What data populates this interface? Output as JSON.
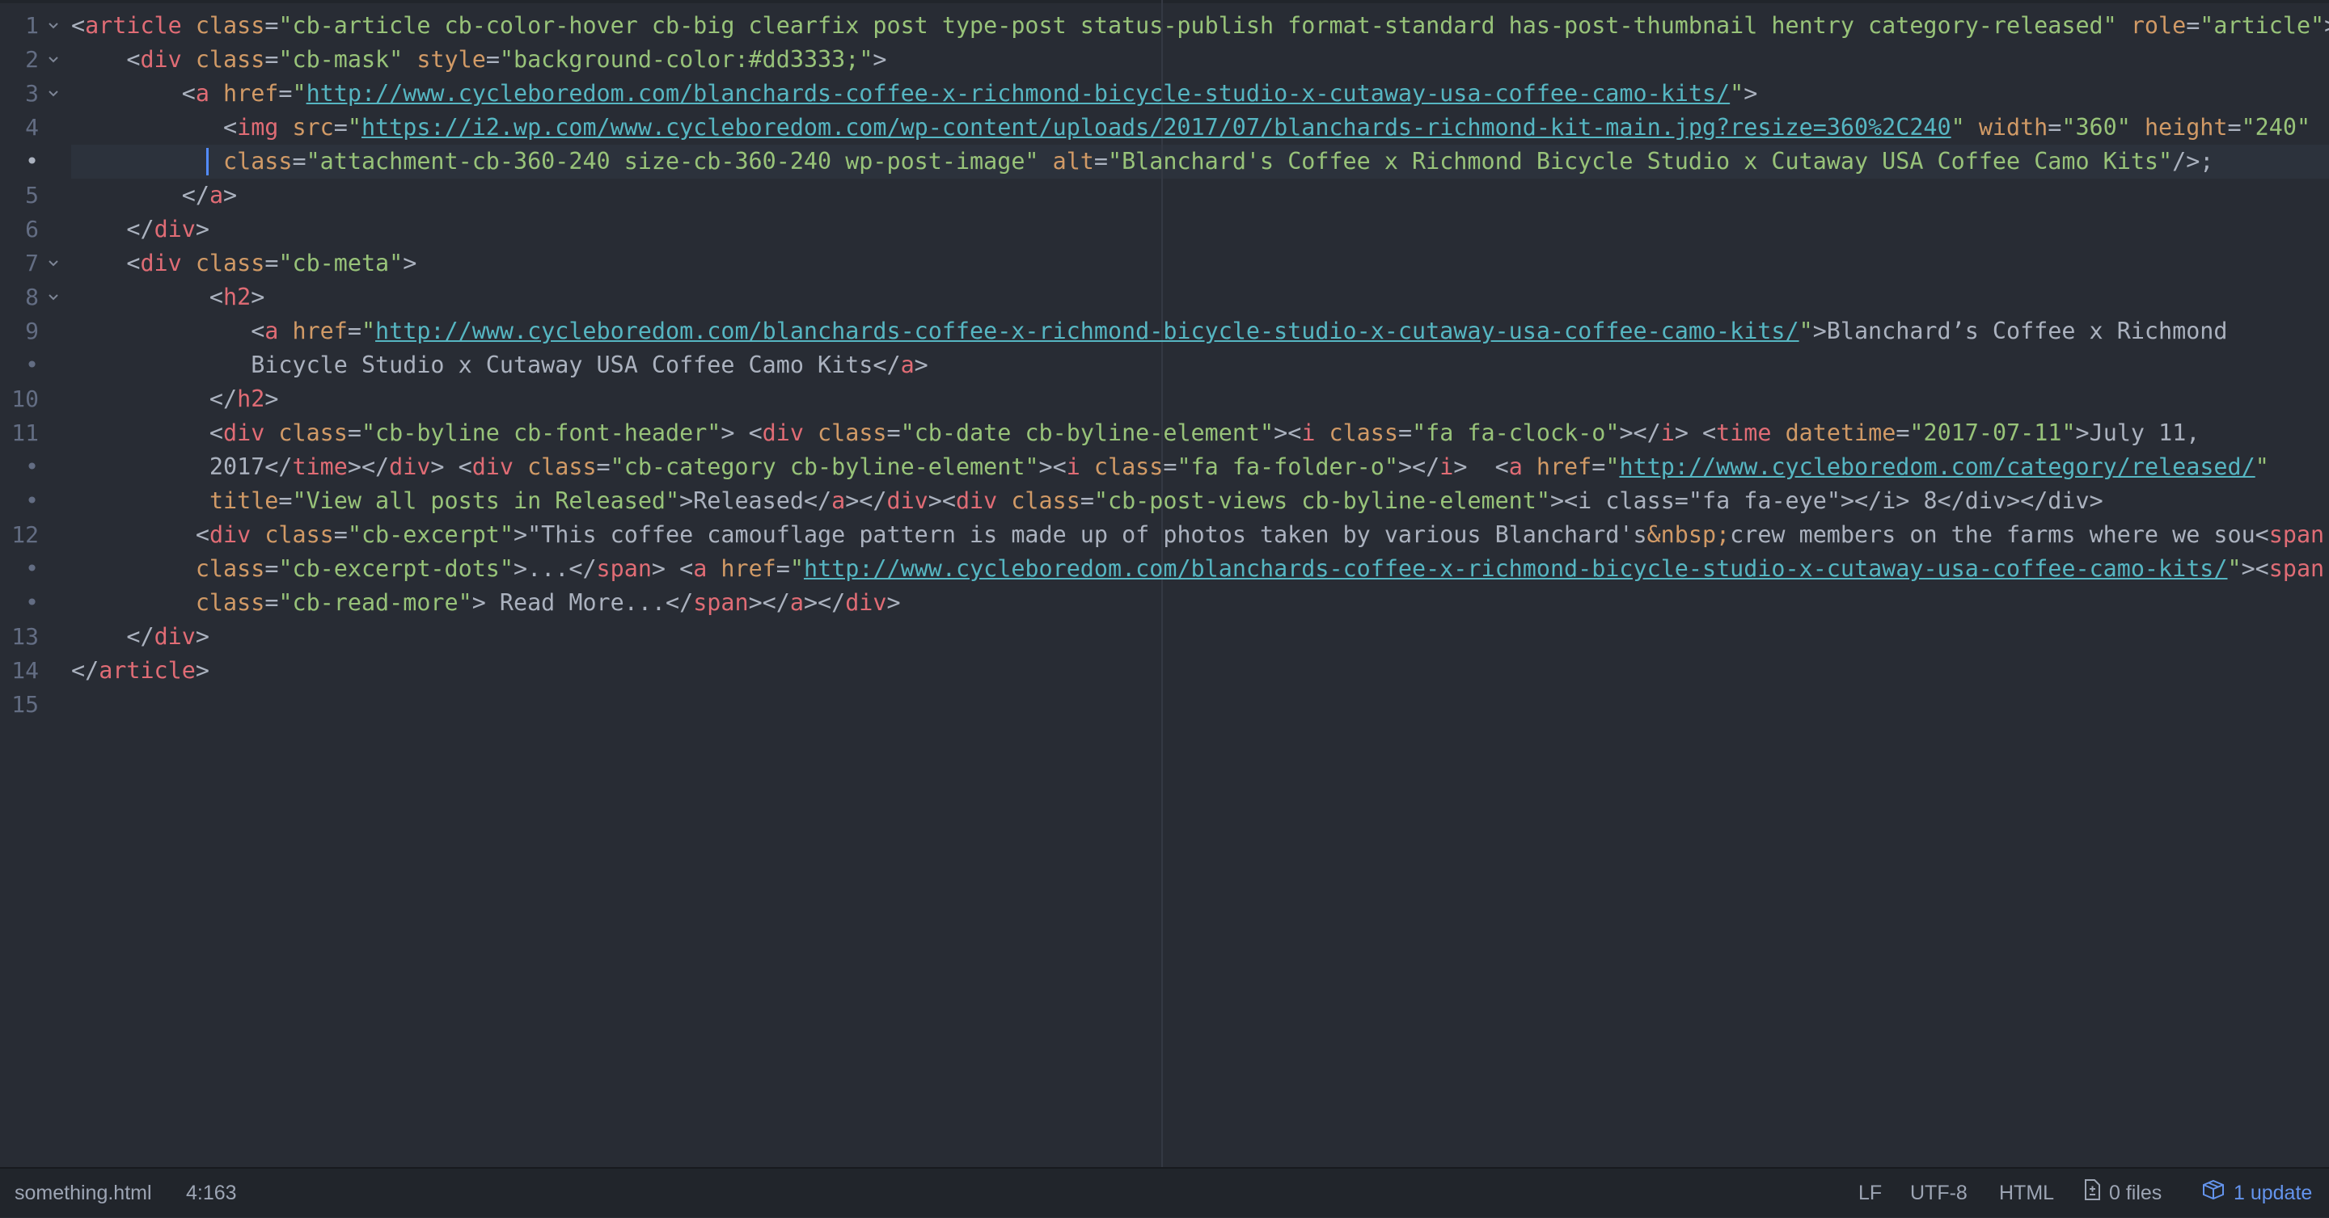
{
  "editor": {
    "lines": [
      {
        "num": "1",
        "fold": true,
        "segments": [
          [
            "p",
            "<"
          ],
          [
            "t",
            "article"
          ],
          [
            "p",
            " "
          ],
          [
            "a",
            "class"
          ],
          [
            "p",
            "="
          ],
          [
            "s",
            "\"cb-article cb-color-hover cb-big clearfix post type-post status-publish format-standard has-post-thumbnail hentry category-released\""
          ],
          [
            "p",
            " "
          ],
          [
            "a",
            "role"
          ],
          [
            "p",
            "="
          ],
          [
            "s",
            "\"article\""
          ],
          [
            "p",
            ">"
          ]
        ]
      },
      {
        "num": "2",
        "fold": true,
        "segments": [
          [
            "p",
            "    <"
          ],
          [
            "t",
            "div"
          ],
          [
            "p",
            " "
          ],
          [
            "a",
            "class"
          ],
          [
            "p",
            "="
          ],
          [
            "s",
            "\"cb-mask\""
          ],
          [
            "p",
            " "
          ],
          [
            "a",
            "style"
          ],
          [
            "p",
            "="
          ],
          [
            "s",
            "\"background-color:#dd3333;\""
          ],
          [
            "p",
            ">"
          ]
        ]
      },
      {
        "num": "3",
        "fold": true,
        "segments": [
          [
            "p",
            "        <"
          ],
          [
            "t",
            "a"
          ],
          [
            "p",
            " "
          ],
          [
            "a",
            "href"
          ],
          [
            "p",
            "="
          ],
          [
            "s",
            "\""
          ],
          [
            "u",
            "http://www.cycleboredom.com/blanchards-coffee-x-richmond-bicycle-studio-x-cutaway-usa-coffee-camo-kits/"
          ],
          [
            "s",
            "\""
          ],
          [
            "p",
            ">"
          ]
        ]
      },
      {
        "num": "4",
        "fold": false,
        "segments": [
          [
            "p",
            "           <"
          ],
          [
            "t",
            "img"
          ],
          [
            "p",
            " "
          ],
          [
            "a",
            "src"
          ],
          [
            "p",
            "="
          ],
          [
            "s",
            "\""
          ],
          [
            "u",
            "https://i2.wp.com/www.cycleboredom.com/wp-content/uploads/2017/07/blanchards-richmond-kit-main.jpg?resize=360%2C240"
          ],
          [
            "s",
            "\""
          ],
          [
            "p",
            " "
          ],
          [
            "a",
            "width"
          ],
          [
            "p",
            "="
          ],
          [
            "s",
            "\"360\""
          ],
          [
            "p",
            " "
          ],
          [
            "a",
            "height"
          ],
          [
            "p",
            "="
          ],
          [
            "s",
            "\"240\""
          ]
        ]
      },
      {
        "num": "•",
        "fold": false,
        "segments": [
          [
            "p",
            "           "
          ],
          [
            "a",
            "class"
          ],
          [
            "p",
            "="
          ],
          [
            "s",
            "\"attachment-cb-360-240 size-cb-360-240 wp-post-image\""
          ],
          [
            "p",
            " "
          ],
          [
            "a",
            "alt"
          ],
          [
            "p",
            "="
          ],
          [
            "s",
            "\"Blanchard's Coffee x Richmond Bicycle Studio x Cutaway USA Coffee Camo Kits\""
          ],
          [
            "p",
            "/>;"
          ]
        ]
      },
      {
        "num": "5",
        "fold": false,
        "segments": [
          [
            "p",
            "        </"
          ],
          [
            "t",
            "a"
          ],
          [
            "p",
            ">"
          ]
        ]
      },
      {
        "num": "6",
        "fold": false,
        "segments": [
          [
            "p",
            "    </"
          ],
          [
            "t",
            "div"
          ],
          [
            "p",
            ">"
          ]
        ]
      },
      {
        "num": "7",
        "fold": true,
        "segments": [
          [
            "p",
            "    <"
          ],
          [
            "t",
            "div"
          ],
          [
            "p",
            " "
          ],
          [
            "a",
            "class"
          ],
          [
            "p",
            "="
          ],
          [
            "s",
            "\"cb-meta\""
          ],
          [
            "p",
            ">"
          ]
        ]
      },
      {
        "num": "8",
        "fold": true,
        "segments": [
          [
            "p",
            "          <"
          ],
          [
            "t",
            "h2"
          ],
          [
            "p",
            ">"
          ]
        ]
      },
      {
        "num": "9",
        "fold": false,
        "segments": [
          [
            "p",
            "             <"
          ],
          [
            "t",
            "a"
          ],
          [
            "p",
            " "
          ],
          [
            "a",
            "href"
          ],
          [
            "p",
            "="
          ],
          [
            "s",
            "\""
          ],
          [
            "u",
            "http://www.cycleboredom.com/blanchards-coffee-x-richmond-bicycle-studio-x-cutaway-usa-coffee-camo-kits/"
          ],
          [
            "s",
            "\""
          ],
          [
            "p",
            ">Blanchard’s Coffee x Richmond"
          ]
        ]
      },
      {
        "num": "•",
        "fold": false,
        "segments": [
          [
            "p",
            "             Bicycle Studio x Cutaway USA Coffee Camo Kits</"
          ],
          [
            "t",
            "a"
          ],
          [
            "p",
            ">"
          ]
        ]
      },
      {
        "num": "10",
        "fold": false,
        "segments": [
          [
            "p",
            "          </"
          ],
          [
            "t",
            "h2"
          ],
          [
            "p",
            ">"
          ]
        ]
      },
      {
        "num": "11",
        "fold": false,
        "segments": [
          [
            "p",
            "          <"
          ],
          [
            "t",
            "div"
          ],
          [
            "p",
            " "
          ],
          [
            "a",
            "class"
          ],
          [
            "p",
            "="
          ],
          [
            "s",
            "\"cb-byline cb-font-header\""
          ],
          [
            "p",
            "> <"
          ],
          [
            "t",
            "div"
          ],
          [
            "p",
            " "
          ],
          [
            "a",
            "class"
          ],
          [
            "p",
            "="
          ],
          [
            "s",
            "\"cb-date cb-byline-element\""
          ],
          [
            "p",
            "><"
          ],
          [
            "t",
            "i"
          ],
          [
            "p",
            " "
          ],
          [
            "a",
            "class"
          ],
          [
            "p",
            "="
          ],
          [
            "s",
            "\"fa fa-clock-o\""
          ],
          [
            "p",
            "></"
          ],
          [
            "t",
            "i"
          ],
          [
            "p",
            "> <"
          ],
          [
            "t",
            "time"
          ],
          [
            "p",
            " "
          ],
          [
            "a",
            "datetime"
          ],
          [
            "p",
            "="
          ],
          [
            "s",
            "\"2017-07-11\""
          ],
          [
            "p",
            ">July 11,"
          ]
        ]
      },
      {
        "num": "•",
        "fold": false,
        "segments": [
          [
            "p",
            "          2017</"
          ],
          [
            "t",
            "time"
          ],
          [
            "p",
            "></"
          ],
          [
            "t",
            "div"
          ],
          [
            "p",
            "> <"
          ],
          [
            "t",
            "div"
          ],
          [
            "p",
            " "
          ],
          [
            "a",
            "class"
          ],
          [
            "p",
            "="
          ],
          [
            "s",
            "\"cb-category cb-byline-element\""
          ],
          [
            "p",
            "><"
          ],
          [
            "t",
            "i"
          ],
          [
            "p",
            " "
          ],
          [
            "a",
            "class"
          ],
          [
            "p",
            "="
          ],
          [
            "s",
            "\"fa fa-folder-o\""
          ],
          [
            "p",
            "></"
          ],
          [
            "t",
            "i"
          ],
          [
            "p",
            ">  <"
          ],
          [
            "t",
            "a"
          ],
          [
            "p",
            " "
          ],
          [
            "a",
            "href"
          ],
          [
            "p",
            "="
          ],
          [
            "s",
            "\""
          ],
          [
            "u",
            "http://www.cycleboredom.com/category/released/"
          ],
          [
            "s",
            "\""
          ]
        ]
      },
      {
        "num": "•",
        "fold": false,
        "segments": [
          [
            "p",
            "          "
          ],
          [
            "a",
            "title"
          ],
          [
            "p",
            "="
          ],
          [
            "s",
            "\"View all posts in Released\""
          ],
          [
            "p",
            ">Released</"
          ],
          [
            "t",
            "a"
          ],
          [
            "p",
            "></"
          ],
          [
            "t",
            "div"
          ],
          [
            "p",
            "><"
          ],
          [
            "t",
            "div"
          ],
          [
            "p",
            " "
          ],
          [
            "a",
            "class"
          ],
          [
            "p",
            "="
          ],
          [
            "s",
            "\"cb-post-views cb-byline-element\""
          ],
          [
            "p",
            "><i class=\"fa fa-eye\"></i> 8</div></div>"
          ]
        ]
      },
      {
        "num": "12",
        "fold": false,
        "segments": [
          [
            "p",
            "         <"
          ],
          [
            "t",
            "div"
          ],
          [
            "p",
            " "
          ],
          [
            "a",
            "class"
          ],
          [
            "p",
            "="
          ],
          [
            "s",
            "\"cb-excerpt\""
          ],
          [
            "p",
            ">\"This coffee camouflage pattern is made up of photos taken by various Blanchard's"
          ],
          [
            "e",
            "&nbsp;"
          ],
          [
            "p",
            "crew members on the farms where we sou<"
          ],
          [
            "t",
            "span"
          ]
        ]
      },
      {
        "num": "•",
        "fold": false,
        "segments": [
          [
            "p",
            "         "
          ],
          [
            "a",
            "class"
          ],
          [
            "p",
            "="
          ],
          [
            "s",
            "\"cb-excerpt-dots\""
          ],
          [
            "p",
            ">...</"
          ],
          [
            "t",
            "span"
          ],
          [
            "p",
            "> <"
          ],
          [
            "t",
            "a"
          ],
          [
            "p",
            " "
          ],
          [
            "a",
            "href"
          ],
          [
            "p",
            "="
          ],
          [
            "s",
            "\""
          ],
          [
            "u",
            "http://www.cycleboredom.com/blanchards-coffee-x-richmond-bicycle-studio-x-cutaway-usa-coffee-camo-kits/"
          ],
          [
            "s",
            "\""
          ],
          [
            "p",
            "><"
          ],
          [
            "t",
            "span"
          ]
        ]
      },
      {
        "num": "•",
        "fold": false,
        "segments": [
          [
            "p",
            "         "
          ],
          [
            "a",
            "class"
          ],
          [
            "p",
            "="
          ],
          [
            "s",
            "\"cb-read-more\""
          ],
          [
            "p",
            "> Read More...</"
          ],
          [
            "t",
            "span"
          ],
          [
            "p",
            "></"
          ],
          [
            "t",
            "a"
          ],
          [
            "p",
            "></"
          ],
          [
            "t",
            "div"
          ],
          [
            "p",
            ">"
          ]
        ]
      },
      {
        "num": "13",
        "fold": false,
        "segments": [
          [
            "p",
            "    </"
          ],
          [
            "t",
            "div"
          ],
          [
            "p",
            ">"
          ]
        ]
      },
      {
        "num": "14",
        "fold": false,
        "segments": [
          [
            "p",
            "</"
          ],
          [
            "t",
            "article"
          ],
          [
            "p",
            ">"
          ]
        ]
      },
      {
        "num": "15",
        "fold": false,
        "segments": []
      }
    ],
    "active_line_index": 4
  },
  "statusbar": {
    "file_name": "something.html",
    "cursor_position": "4:163",
    "line_ending": "LF",
    "encoding": "UTF-8",
    "grammar": "HTML",
    "files_label": "0 files",
    "update_label": "1 update"
  },
  "colors": {
    "background": "#282c34",
    "tag": "#e06c75",
    "attribute": "#d19a66",
    "string": "#98c379",
    "url": "#56b6c2",
    "text": "#abb2bf",
    "accent": "#6494ed"
  },
  "icons": {
    "fold": "chevron-down-icon",
    "files": "file-diff-icon",
    "update": "package-icon"
  }
}
